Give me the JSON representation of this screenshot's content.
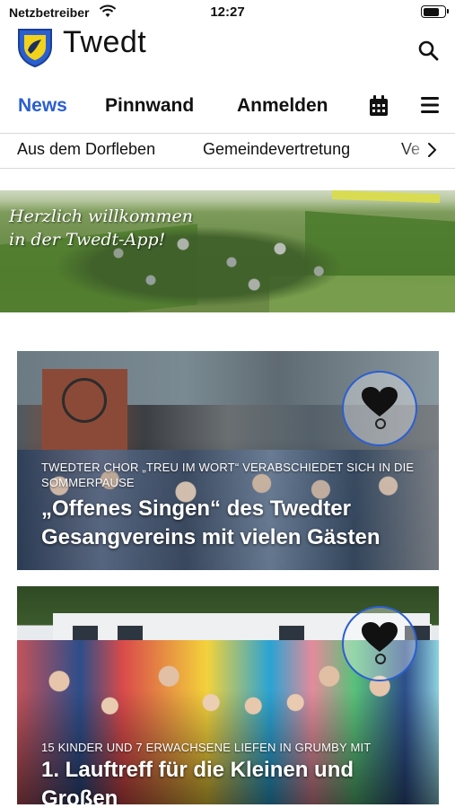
{
  "status": {
    "carrier": "Netzbetreiber",
    "time": "12:27",
    "battery_level": 0.8
  },
  "app": {
    "title": "Twedt",
    "brand_color": "#2b5fd0"
  },
  "tabs": [
    {
      "label": "News",
      "active": true
    },
    {
      "label": "Pinnwand",
      "active": false
    },
    {
      "label": "Anmelden",
      "active": false
    }
  ],
  "icons": {
    "calendar": "calendar-icon",
    "menu": "hamburger-menu-icon",
    "search": "search-icon"
  },
  "subcategories": [
    "Aus dem Dorfleben",
    "Gemeindevertretung",
    "Ve"
  ],
  "banner": {
    "line1": "Herzlich willkommen",
    "line2": "in der Twedt-App!"
  },
  "cards": [
    {
      "overline": "Twedter Chor „Treu im Wort“ verabschiedet sich in die Sommerpause",
      "title": "„Offenes Singen“ des Twedter Gesangvereins mit vielen Gästen"
    },
    {
      "overline": "15 Kinder und 7 Erwachsene liefen in Grumby mit",
      "title": "1. Lauftreff für die Kleinen und Großen"
    }
  ]
}
